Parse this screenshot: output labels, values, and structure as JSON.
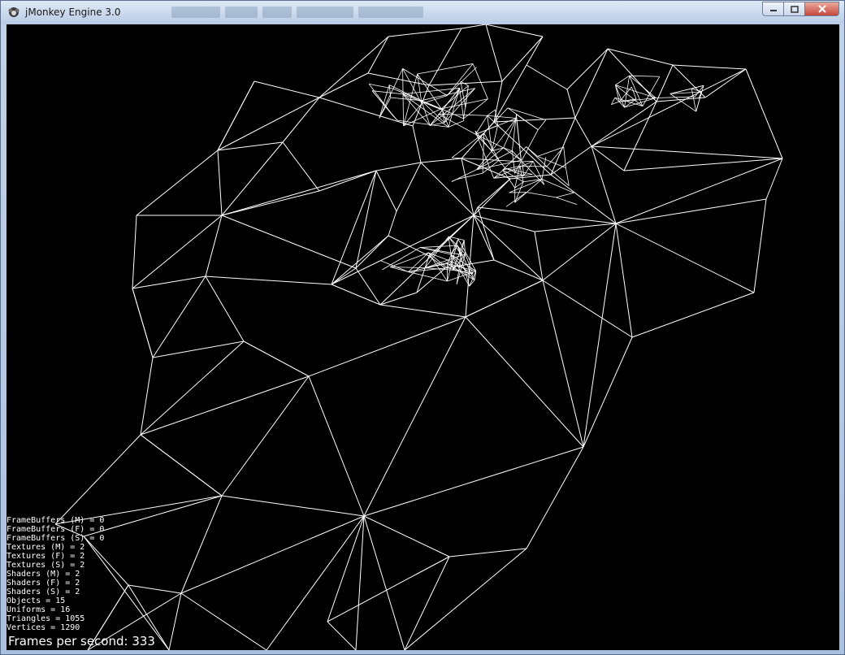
{
  "window": {
    "title": "jMonkey Engine 3.0",
    "buttons": [
      "minimize",
      "maximize",
      "close"
    ]
  },
  "colors": {
    "background": "#000000",
    "wireframe": "#ffffff",
    "text": "#ffffff"
  },
  "stats": [
    {
      "label": "FrameBuffers (M)",
      "value": "0"
    },
    {
      "label": "FrameBuffers (F)",
      "value": "0"
    },
    {
      "label": "FrameBuffers (S)",
      "value": "0"
    },
    {
      "label": "Textures (M)",
      "value": "2"
    },
    {
      "label": "Textures (F)",
      "value": "2"
    },
    {
      "label": "Textures (S)",
      "value": "2"
    },
    {
      "label": "Shaders (M)",
      "value": "2"
    },
    {
      "label": "Shaders (F)",
      "value": "2"
    },
    {
      "label": "Shaders (S)",
      "value": "2"
    },
    {
      "label": "Objects",
      "value": "15"
    },
    {
      "label": "Uniforms",
      "value": "16"
    },
    {
      "label": "Triangles",
      "value": "1055"
    },
    {
      "label": "Vertices",
      "value": "1290"
    }
  ],
  "fps": {
    "label": "Frames per second:",
    "value": "333"
  }
}
